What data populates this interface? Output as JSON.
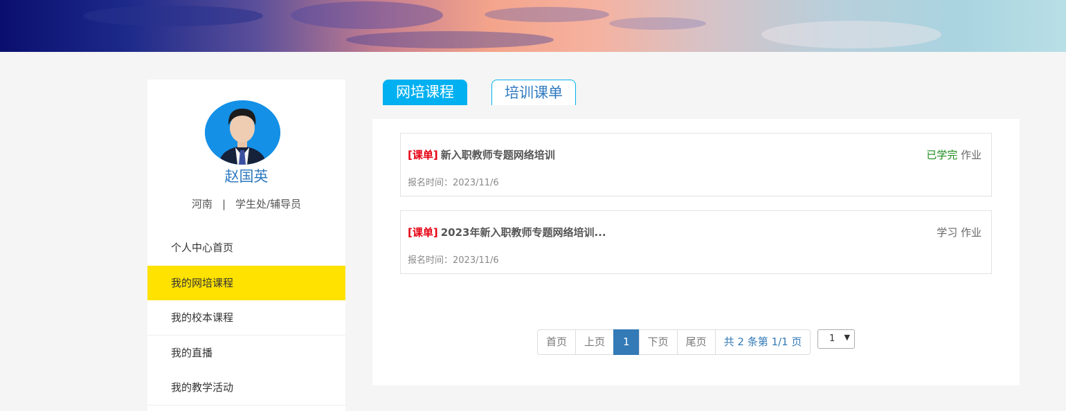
{
  "profile": {
    "name": "赵国英",
    "region": "河南",
    "separator": "|",
    "department": "学生处/辅导员"
  },
  "menu": [
    {
      "label": "个人中心首页",
      "active": false
    },
    {
      "label": "我的网培课程",
      "active": true
    },
    {
      "label": "我的校本课程",
      "active": false
    },
    {
      "label": "我的直播",
      "active": false
    },
    {
      "label": "我的教学活动",
      "active": false
    }
  ],
  "tabs": [
    {
      "label": "网培课程",
      "active": true
    },
    {
      "label": "培训课单",
      "active": false
    }
  ],
  "courses": [
    {
      "tag": "[课单]",
      "title": "新入职教师专题网络培训",
      "date_label": "报名时间：",
      "date": "2023/11/6",
      "status": "已学完",
      "action": "作业"
    },
    {
      "tag": "[课单]",
      "title": "2023年新入职教师专题网络培训...",
      "date_label": "报名时间：",
      "date": "2023/11/6",
      "status": "学习",
      "action": "作业"
    }
  ],
  "pagination": {
    "first": "首页",
    "prev": "上页",
    "current": "1",
    "next": "下页",
    "last": "尾页",
    "info": "共 2 条第 1/1 页",
    "select_value": "1"
  },
  "colors": {
    "accent": "#00b0f0",
    "active_menu": "#ffe200",
    "tag": "#e60012",
    "done": "#1a8a1a",
    "link": "#337ab7"
  }
}
